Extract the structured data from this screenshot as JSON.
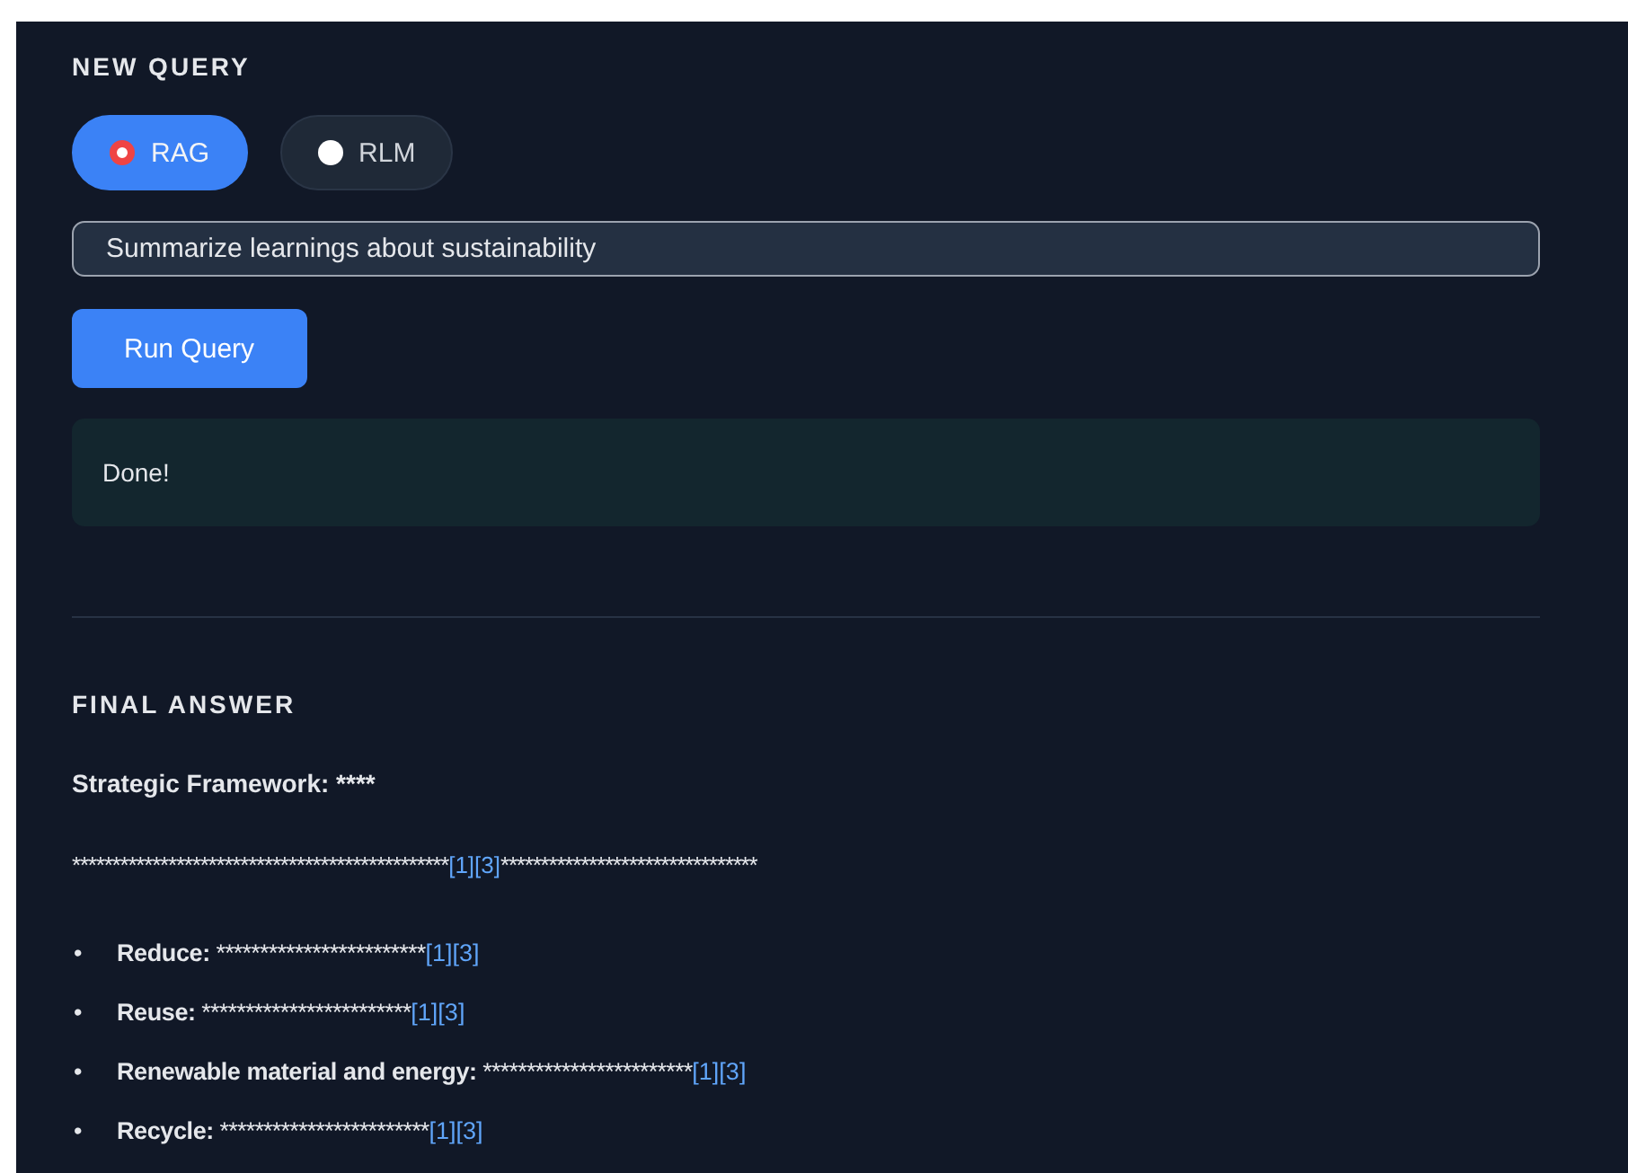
{
  "new_query": {
    "heading": "NEW QUERY",
    "modes": [
      {
        "label": "RAG",
        "selected": true
      },
      {
        "label": "RLM",
        "selected": false
      }
    ],
    "query_field": {
      "value": "Summarize learnings about sustainability"
    },
    "run_button": "Run Query",
    "status": "Done!"
  },
  "final_answer": {
    "heading": "FINAL ANSWER",
    "title": "Strategic Framework: ****",
    "summary": {
      "before": "***********************************************",
      "citations": "[1][3]",
      "after": "********************************"
    },
    "bullets": [
      {
        "marker": "•",
        "label": "Reduce:",
        "text": "************************",
        "citations": "[1][3]"
      },
      {
        "marker": "•",
        "label": "Reuse:",
        "text": "************************",
        "citations": "[1][3]"
      },
      {
        "marker": "•",
        "label": "Renewable material and energy:",
        "text": "************************",
        "citations": "[1][3]"
      },
      {
        "marker": "•",
        "label": "Recycle:",
        "text": "************************",
        "citations": "[1][3]"
      }
    ]
  }
}
